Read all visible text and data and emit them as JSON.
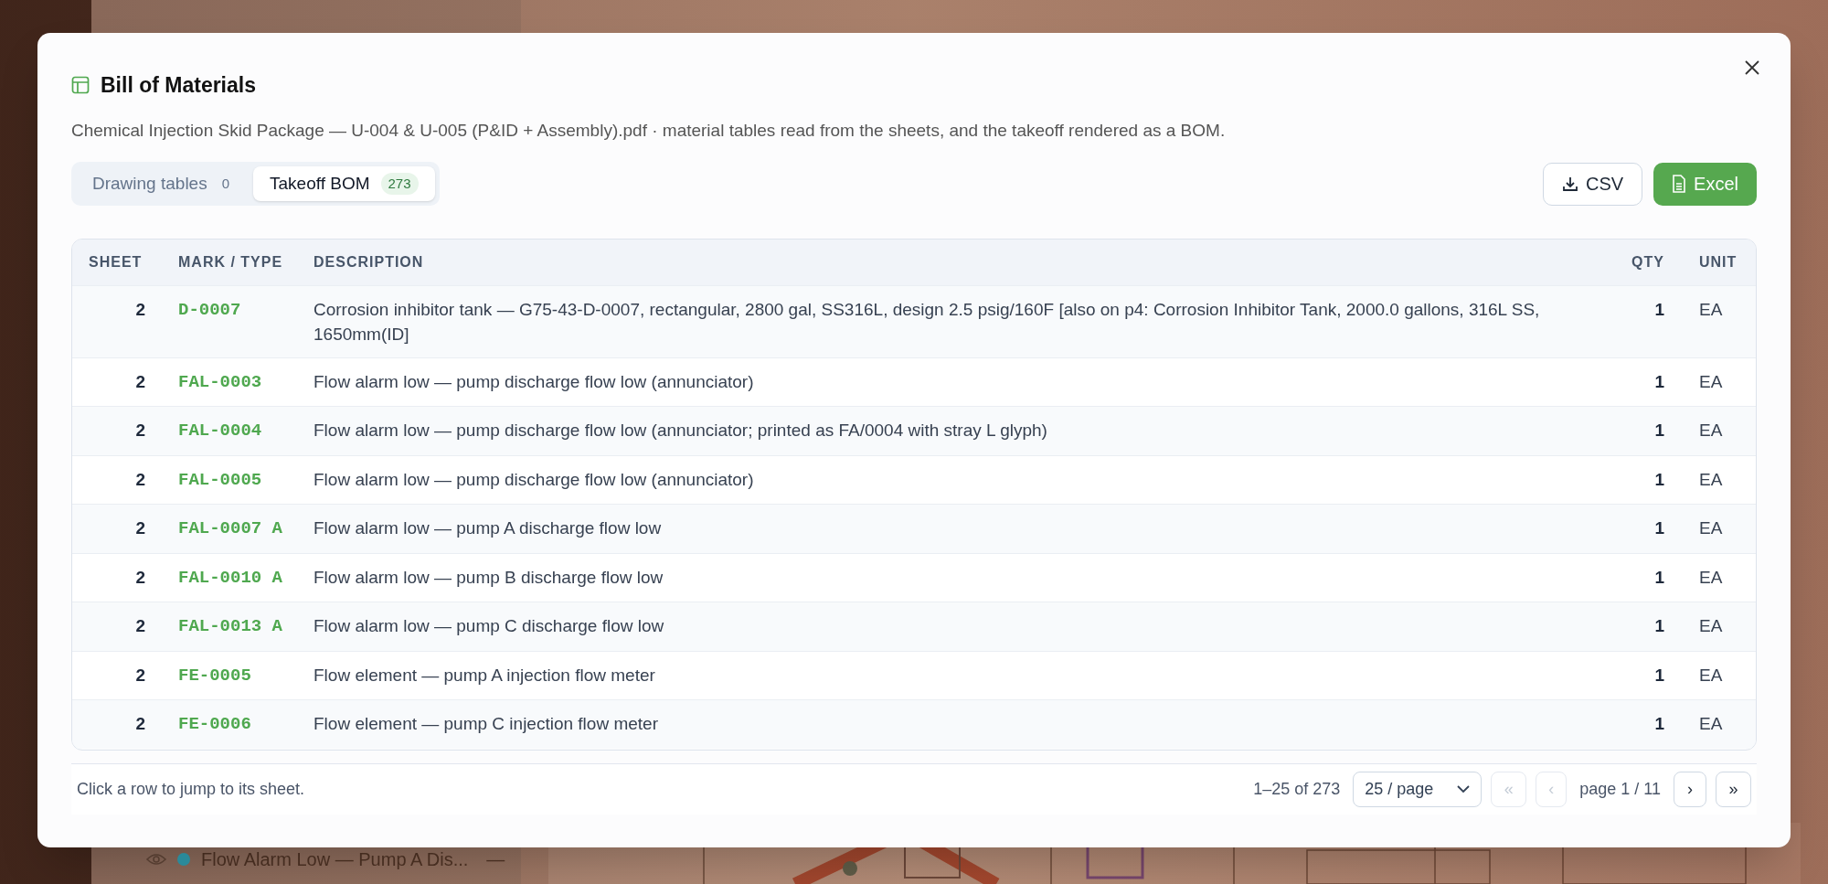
{
  "background": {
    "layer_item": {
      "label": "Flow Alarm Low — Pump A Dis...",
      "color": "#2a8a9a",
      "trailing": "—"
    }
  },
  "dialog": {
    "title": "Bill of Materials",
    "subtitle": "Chemical Injection Skid Package — U-004 & U-005 (P&ID + Assembly).pdf · material tables read from the sheets, and the takeoff rendered as a BOM.",
    "tabs": [
      {
        "label": "Drawing tables",
        "count": "0",
        "selected": false
      },
      {
        "label": "Takeoff BOM",
        "count": "273",
        "selected": true
      }
    ],
    "buttons": [
      {
        "label": "CSV",
        "kind": "outline"
      },
      {
        "label": "Excel",
        "kind": "primary"
      }
    ],
    "table": {
      "columns": [
        "SHEET",
        "MARK / TYPE",
        "DESCRIPTION",
        "QTY",
        "UNIT"
      ],
      "rows": [
        [
          "2",
          "D-0007",
          "Corrosion inhibitor tank — G75-43-D-0007, rectangular, 2800 gal, SS316L, design 2.5 psig/160F [also on p4: Corrosion Inhibitor Tank, 2000.0 gallons, 316L SS, 1650mm(ID]",
          "1",
          "EA"
        ],
        [
          "2",
          "FAL-0003",
          "Flow alarm low — pump discharge flow low (annunciator)",
          "1",
          "EA"
        ],
        [
          "2",
          "FAL-0004",
          "Flow alarm low — pump discharge flow low (annunciator; printed as FA/0004 with stray L glyph)",
          "1",
          "EA"
        ],
        [
          "2",
          "FAL-0005",
          "Flow alarm low — pump discharge flow low (annunciator)",
          "1",
          "EA"
        ],
        [
          "2",
          "FAL-0007 A",
          "Flow alarm low — pump A discharge flow low",
          "1",
          "EA"
        ],
        [
          "2",
          "FAL-0010 A",
          "Flow alarm low — pump B discharge flow low",
          "1",
          "EA"
        ],
        [
          "2",
          "FAL-0013 A",
          "Flow alarm low — pump C discharge flow low",
          "1",
          "EA"
        ],
        [
          "2",
          "FE-0005",
          "Flow element — pump A injection flow meter",
          "1",
          "EA"
        ],
        [
          "2",
          "FE-0006",
          "Flow element — pump C injection flow meter",
          "1",
          "EA"
        ]
      ]
    },
    "footer": {
      "hint": "Click a row to jump to its sheet.",
      "range": "1–25 of 273",
      "page_size": "25 / page",
      "first": {
        "label": "«",
        "disabled": true
      },
      "prev": {
        "label": "‹",
        "disabled": true
      },
      "page": "page 1 / 11",
      "next": {
        "label": "›",
        "disabled": false
      },
      "last": {
        "label": "»",
        "disabled": false
      }
    }
  }
}
